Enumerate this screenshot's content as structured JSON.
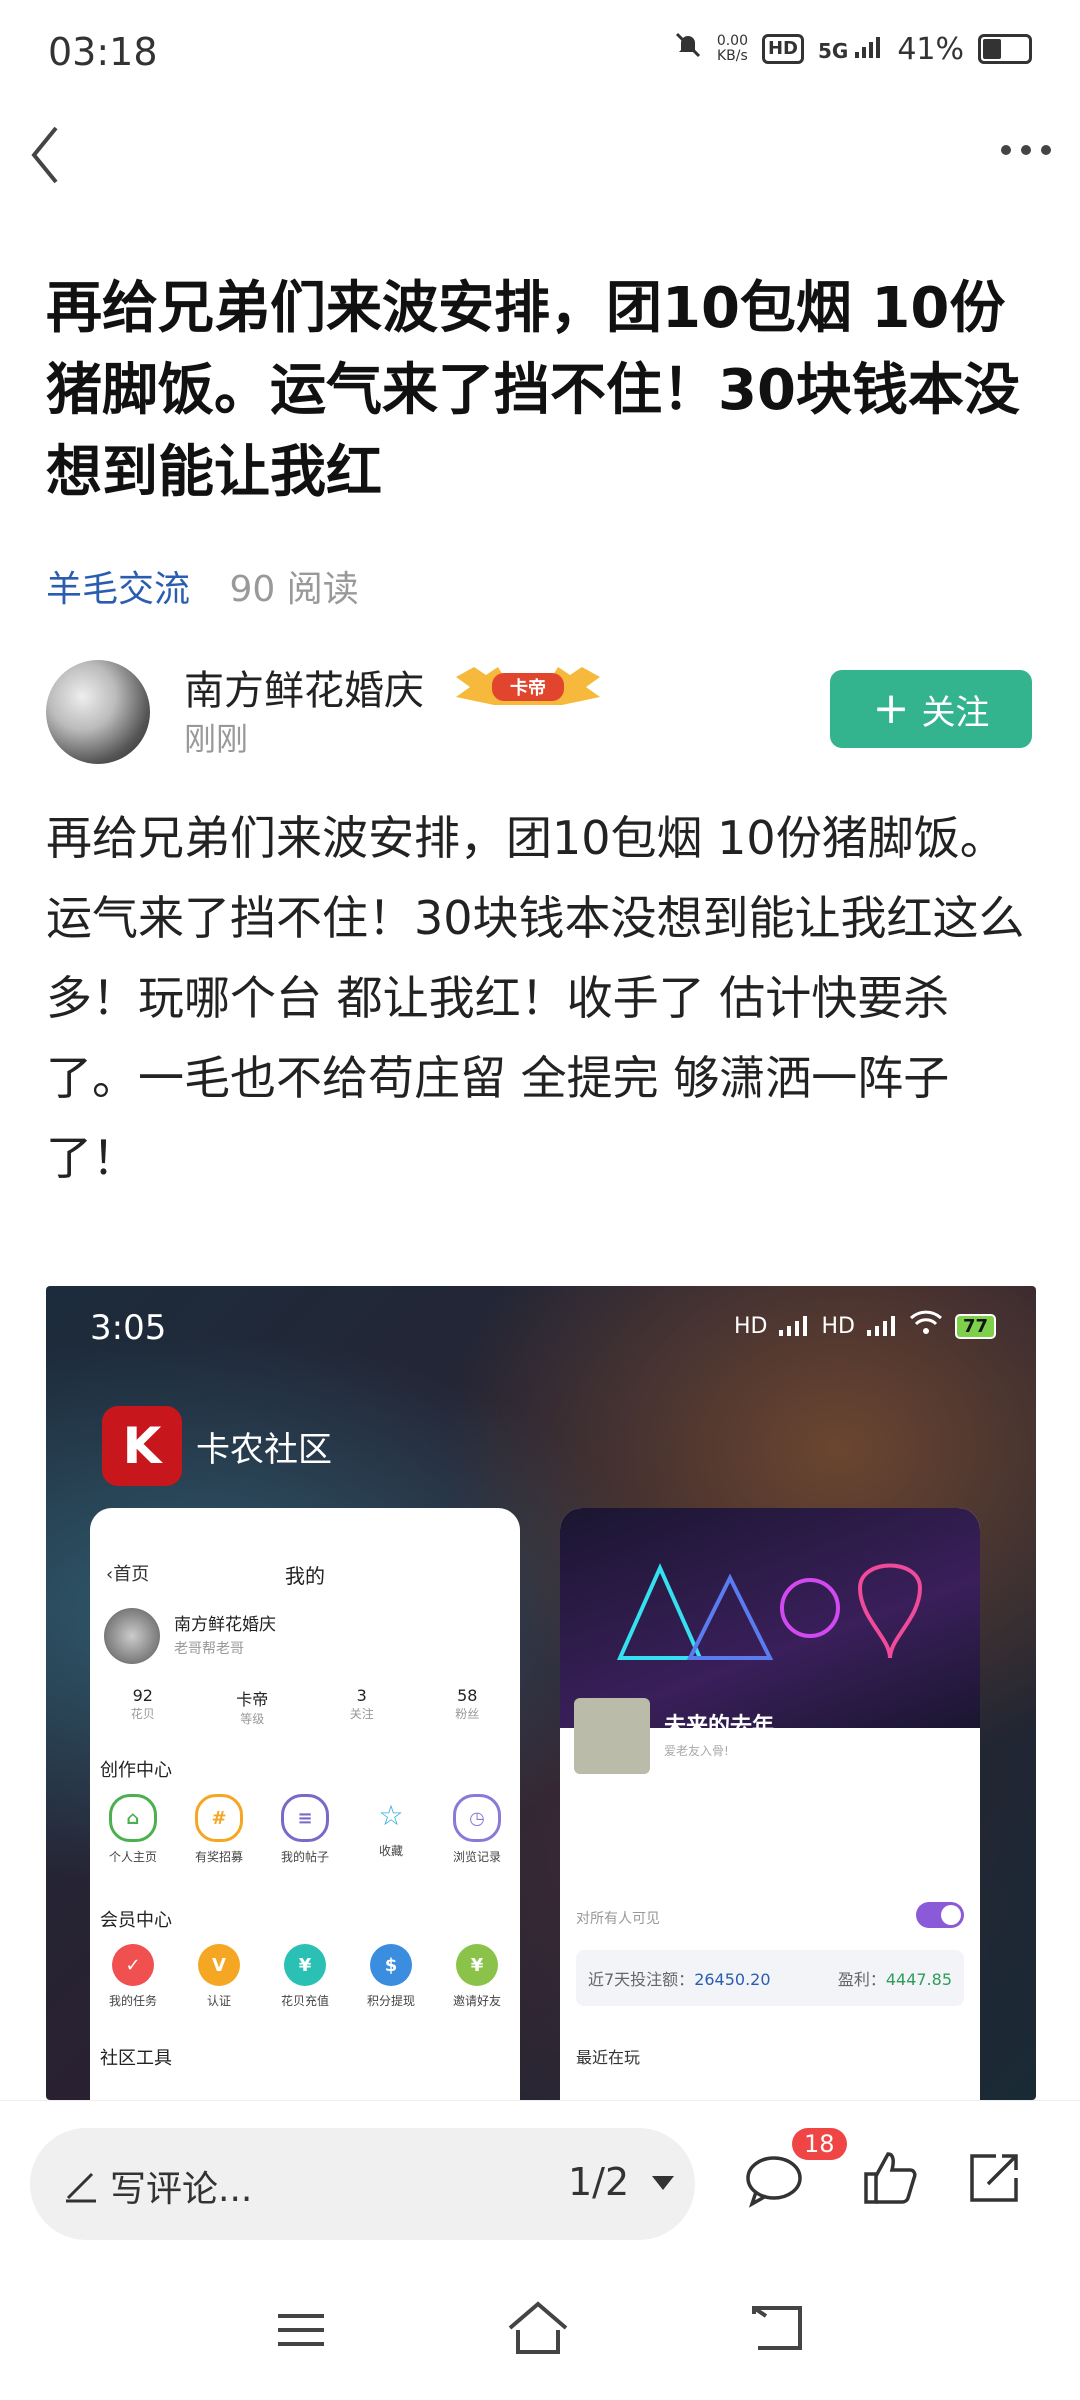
{
  "status_bar": {
    "time": "03:18",
    "net_speed_value": "0.00",
    "net_speed_unit": "KB/s",
    "hd": "HD",
    "network": "5G",
    "battery": "41%"
  },
  "post": {
    "title": "再给兄弟们来波安排，团10包烟 10份猪脚饭。运气来了挡不住！30块钱本没想到能让我红",
    "category": "羊毛交流",
    "reads": "90 阅读",
    "body": "再给兄弟们来波安排，团10包烟 10份猪脚饭。\n运气来了挡不住！30块钱本没想到能让我红这么多！玩哪个台 都让我红！收手了 估计快要杀了。一毛也不给苟庄留 全提完 够潇洒一阵子了！"
  },
  "author": {
    "name": "南方鲜花婚庆",
    "badge": "卡帝",
    "time": "刚刚",
    "follow_label": "关注"
  },
  "embedded": {
    "time": "3:05",
    "status_hd1": "HD",
    "status_hd2": "HD",
    "battery": "77",
    "app_logo_text": "K",
    "app_name": "卡农社区",
    "left_card": {
      "back": "首页",
      "title": "我的",
      "user_name": "南方鲜花婚庆",
      "user_sub": "老哥帮老哥",
      "stats": [
        {
          "value": "92",
          "label": "花贝"
        },
        {
          "value": "卡帝",
          "label": "等级"
        },
        {
          "value": "3",
          "label": "关注"
        },
        {
          "value": "58",
          "label": "粉丝"
        }
      ],
      "section1": "创作中心",
      "section1_items": [
        "个人主页",
        "有奖招募",
        "我的帖子",
        "收藏",
        "浏览记录"
      ],
      "section2": "会员中心",
      "section2_items": [
        "我的任务",
        "认证",
        "花贝充值",
        "积分提现",
        "邀请好友"
      ],
      "section3": "社区工具"
    },
    "right_card": {
      "user_name": "未来的去年",
      "user_sub": "爱老友入骨!",
      "visibility": "对所有人可见",
      "bet_label": "近7天投注额：",
      "bet_value": "26450.20",
      "profit_label": "盈利：",
      "profit_value": "4447.85",
      "recent": "最近在玩"
    }
  },
  "bottom": {
    "comment_placeholder": "写评论...",
    "page_indicator": "1/2",
    "comment_count": "18"
  },
  "colors": {
    "accent_green": "#34b48e",
    "category_blue": "#2a5db0",
    "badge_red": "#f04545"
  },
  "icons": [
    "back-icon",
    "more-icon",
    "plus-icon",
    "pencil-icon",
    "caret-down-icon",
    "chat-icon",
    "like-icon",
    "share-icon",
    "menu-icon",
    "home-icon",
    "return-icon"
  ]
}
